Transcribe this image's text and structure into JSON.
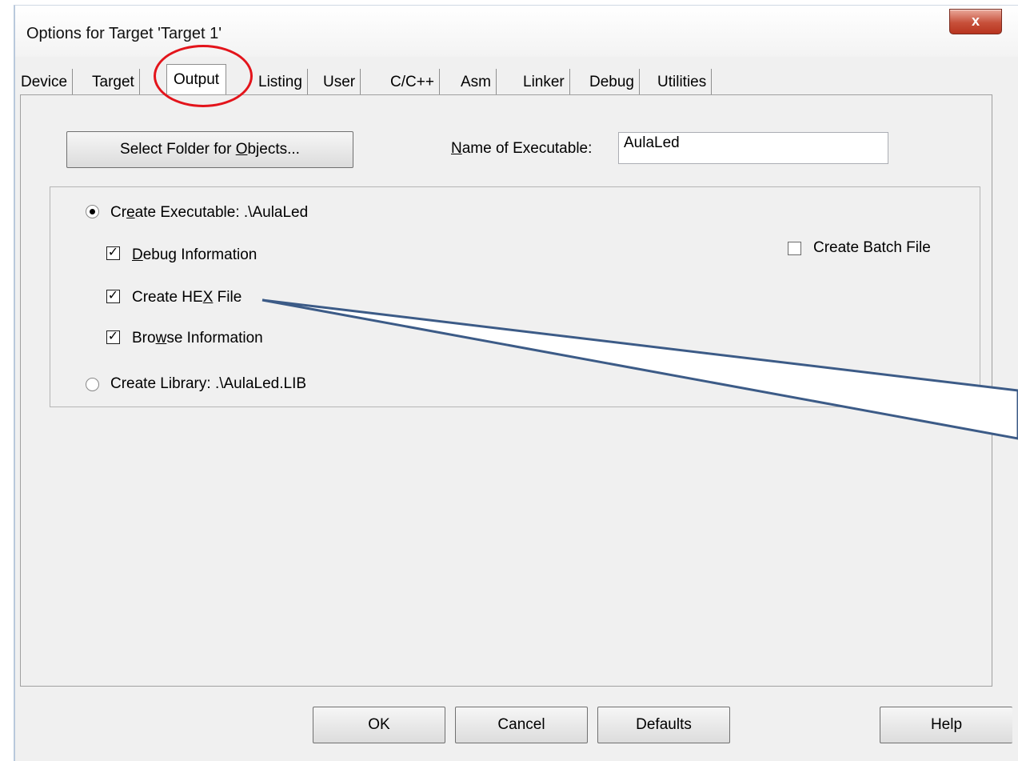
{
  "window": {
    "title": "Options for Target 'Target 1'",
    "close_label": "x"
  },
  "tabs": [
    {
      "label": "Device"
    },
    {
      "label": "Target"
    },
    {
      "label": "Output"
    },
    {
      "label": "Listing"
    },
    {
      "label": "User"
    },
    {
      "label": "C/C++"
    },
    {
      "label": "Asm"
    },
    {
      "label": "Linker"
    },
    {
      "label": "Debug"
    },
    {
      "label": "Utilities"
    }
  ],
  "active_tab": "Output",
  "output": {
    "select_folder": {
      "pre": "Select Folder for ",
      "key": "O",
      "post": "bjects..."
    },
    "name_label": {
      "key": "N",
      "post": "ame of Executable:"
    },
    "name_value": "AulaLed",
    "create_executable": {
      "pre": "Cr",
      "key": "e",
      "post": "ate Executable:  .\\AulaLed",
      "checked": true
    },
    "debug_info": {
      "key": "D",
      "post": "ebug Information",
      "checked": true
    },
    "create_hex": {
      "pre": "Create HE",
      "key": "X",
      "post": " File",
      "checked": true
    },
    "browse_info": {
      "pre": "Bro",
      "key": "w",
      "post": "se Information",
      "checked": true
    },
    "create_library": {
      "label": "Create Library:  .\\AulaLed.LIB",
      "checked": false
    },
    "create_batch": {
      "label": "Create Batch File",
      "checked": false
    }
  },
  "buttons": {
    "ok": "OK",
    "cancel": "Cancel",
    "defaults": "Defaults",
    "help": "Help"
  },
  "colors": {
    "annotation_circle": "#e3141b",
    "callout_stroke": "#3c5b87"
  }
}
